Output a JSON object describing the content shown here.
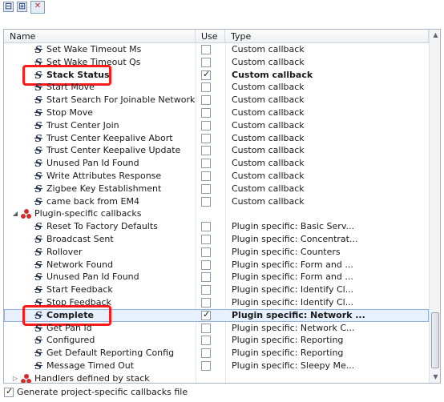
{
  "toolbar": {
    "collapse_all": "⊟",
    "expand_all": "⊞",
    "filter": "✕"
  },
  "table": {
    "columns": {
      "name": "Name",
      "use": "Use",
      "type": "Type"
    },
    "rows": [
      {
        "kind": "item",
        "name": "Set Wake Timeout Ms",
        "checked": false,
        "type": "Custom callback"
      },
      {
        "kind": "item",
        "name": "Set Wake Timeout Qs",
        "checked": false,
        "type": "Custom callback"
      },
      {
        "kind": "item",
        "name": "Stack Status",
        "checked": true,
        "type": "Custom callback",
        "bold": true,
        "highlighted": true
      },
      {
        "kind": "item",
        "name": "Start Move",
        "checked": false,
        "type": "Custom callback"
      },
      {
        "kind": "item",
        "name": "Start Search For Joinable Network",
        "checked": false,
        "type": "Custom callback"
      },
      {
        "kind": "item",
        "name": "Stop Move",
        "checked": false,
        "type": "Custom callback"
      },
      {
        "kind": "item",
        "name": "Trust Center Join",
        "checked": false,
        "type": "Custom callback"
      },
      {
        "kind": "item",
        "name": "Trust Center Keepalive Abort",
        "checked": false,
        "type": "Custom callback"
      },
      {
        "kind": "item",
        "name": "Trust Center Keepalive Update",
        "checked": false,
        "type": "Custom callback"
      },
      {
        "kind": "item",
        "name": "Unused Pan Id Found",
        "checked": false,
        "type": "Custom callback"
      },
      {
        "kind": "item",
        "name": "Write Attributes Response",
        "checked": false,
        "type": "Custom callback"
      },
      {
        "kind": "item",
        "name": "Zigbee Key Establishment",
        "checked": false,
        "type": "Custom callback"
      },
      {
        "kind": "item",
        "name": "came back from EM4",
        "checked": false,
        "type": "Custom callback"
      },
      {
        "kind": "group",
        "name": "Plugin-specific callbacks",
        "expanded": true
      },
      {
        "kind": "item",
        "name": "Reset To Factory Defaults",
        "checked": false,
        "type": "Plugin specific: Basic Serv..."
      },
      {
        "kind": "item",
        "name": "Broadcast Sent",
        "checked": false,
        "type": "Plugin specific: Concentrat..."
      },
      {
        "kind": "item",
        "name": "Rollover",
        "checked": false,
        "type": "Plugin specific: Counters"
      },
      {
        "kind": "item",
        "name": "Network Found",
        "checked": false,
        "type": "Plugin specific: Form and ..."
      },
      {
        "kind": "item",
        "name": "Unused Pan Id Found",
        "checked": false,
        "type": "Plugin specific: Form and ..."
      },
      {
        "kind": "item",
        "name": "Start Feedback",
        "checked": false,
        "type": "Plugin specific: Identify Cl..."
      },
      {
        "kind": "item",
        "name": "Stop Feedback",
        "checked": false,
        "type": "Plugin specific: Identify Cl..."
      },
      {
        "kind": "item",
        "name": "Complete",
        "checked": true,
        "type": "Plugin specific: Network ...",
        "bold": true,
        "selected": true,
        "highlighted": true
      },
      {
        "kind": "item",
        "name": "Get Pan Id",
        "checked": false,
        "type": "Plugin specific: Network C..."
      },
      {
        "kind": "item",
        "name": "Configured",
        "checked": false,
        "type": "Plugin specific: Reporting"
      },
      {
        "kind": "item",
        "name": "Get Default Reporting Config",
        "checked": false,
        "type": "Plugin specific: Reporting"
      },
      {
        "kind": "item",
        "name": "Message Timed Out",
        "checked": false,
        "type": "Plugin specific: Sleepy Me..."
      },
      {
        "kind": "group",
        "name": "Handlers defined by stack",
        "expanded": false
      }
    ]
  },
  "footer": {
    "label": "Generate project-specific callbacks file",
    "checked": true
  },
  "colors": {
    "highlight": "#ff1a1a",
    "selection": "#e7f0fb",
    "plugin_icon": "#d22d2d"
  },
  "icons": {
    "callback": "callback-s-icon",
    "group": "plugin-group-icon"
  }
}
